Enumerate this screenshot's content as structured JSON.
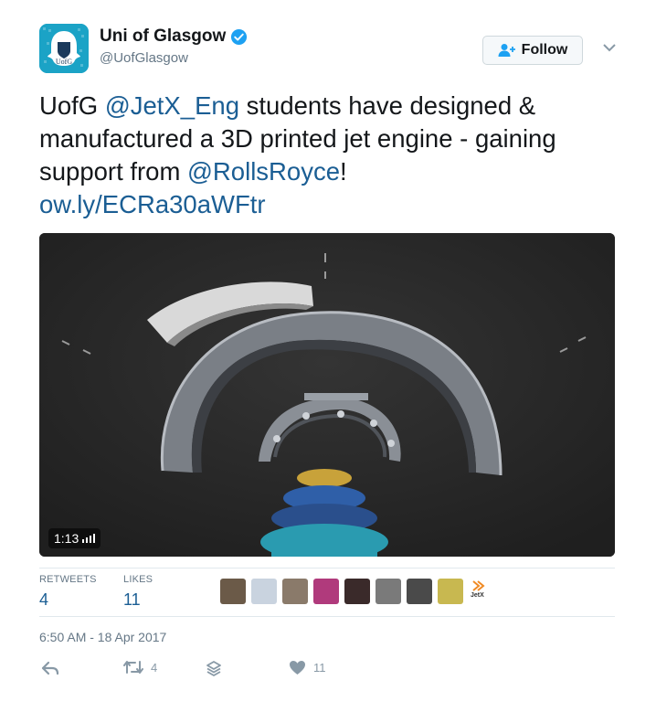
{
  "account": {
    "display_name": "Uni of Glasgow",
    "handle": "@UofGlasgow",
    "avatar_text": "UofG",
    "verified": true
  },
  "follow": {
    "label": "Follow"
  },
  "tweet": {
    "text_parts": {
      "p1": "UofG ",
      "mention1": "@JetX_Eng",
      "p2": " students have designed & manufactured a 3D printed jet engine - gaining support from ",
      "mention2": "@RollsRoyce",
      "p3": "!",
      "link": "ow.ly/ECRa30aWFtr"
    }
  },
  "media": {
    "duration": "1:13",
    "type": "video"
  },
  "stats": {
    "retweets_label": "RETWEETS",
    "retweets_value": "4",
    "likes_label": "LIKES",
    "likes_value": "11"
  },
  "liker_avatars": [
    "#6b5a48",
    "#c9d3df",
    "#8a7a6a",
    "#b03a7c",
    "#3a2a2a",
    "#7a7a7a",
    "#4a4a4a",
    "#c8b850",
    "#f08a24"
  ],
  "liker_last_text": "JetX",
  "timestamp": "6:50 AM - 18 Apr 2017",
  "actions": {
    "retweet_count": "4",
    "like_count": "11"
  },
  "colors": {
    "link": "#1b5e94",
    "avatar_bg": "#1ba3c6",
    "verified": "#1da1f2"
  }
}
